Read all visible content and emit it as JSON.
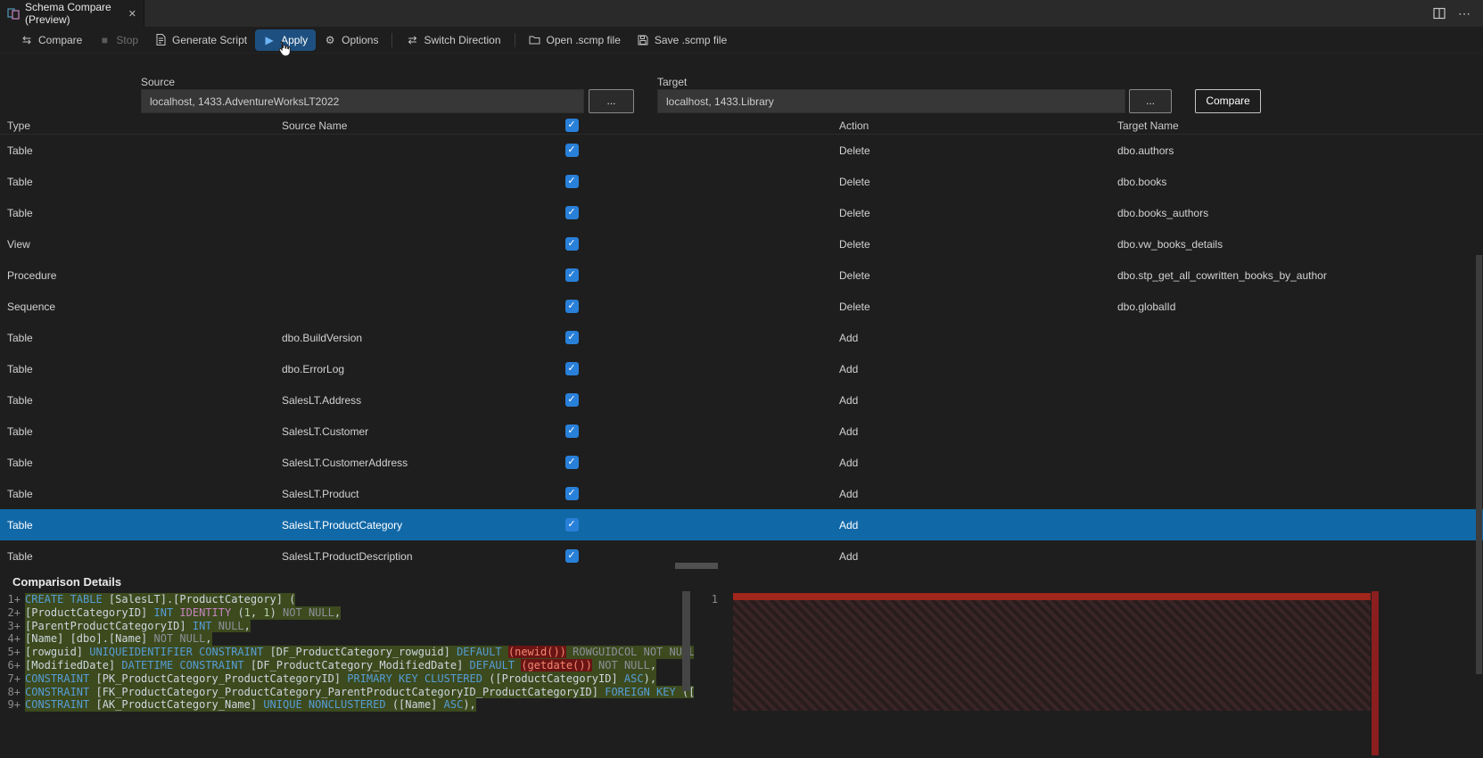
{
  "tab": {
    "title": "Schema Compare (Preview)",
    "close_glyph": "✕"
  },
  "window_controls": {
    "split_editor_icon": "split-editor",
    "more_actions_icon": "⋯"
  },
  "toolbar": {
    "items": [
      {
        "id": "compare",
        "label": "Compare",
        "enabled": true,
        "active": false
      },
      {
        "id": "stop",
        "label": "Stop",
        "enabled": false,
        "active": false
      },
      {
        "id": "generate-script",
        "label": "Generate Script",
        "enabled": true,
        "active": false
      },
      {
        "id": "apply",
        "label": "Apply",
        "enabled": true,
        "active": true
      },
      {
        "id": "options",
        "label": "Options",
        "enabled": true,
        "active": false
      },
      {
        "id": "switch-direction",
        "label": "Switch Direction",
        "enabled": true,
        "active": false
      },
      {
        "id": "open-scmp",
        "label": "Open .scmp file",
        "enabled": true,
        "active": false
      },
      {
        "id": "save-scmp",
        "label": "Save .scmp file",
        "enabled": true,
        "active": false
      }
    ]
  },
  "connections": {
    "source": {
      "label": "Source",
      "value": "localhost, 1433.AdventureWorksLT2022",
      "browse": "..."
    },
    "target": {
      "label": "Target",
      "value": "localhost, 1433.Library",
      "browse": "..."
    },
    "compare_button": "Compare"
  },
  "grid": {
    "headers": {
      "type": "Type",
      "source_name": "Source Name",
      "action": "Action",
      "target_name": "Target Name"
    },
    "header_checkbox_checked": true,
    "rows": [
      {
        "type": "Table",
        "source": "",
        "checked": true,
        "action": "Delete",
        "target": "dbo.authors",
        "selected": false
      },
      {
        "type": "Table",
        "source": "",
        "checked": true,
        "action": "Delete",
        "target": "dbo.books",
        "selected": false
      },
      {
        "type": "Table",
        "source": "",
        "checked": true,
        "action": "Delete",
        "target": "dbo.books_authors",
        "selected": false
      },
      {
        "type": "View",
        "source": "",
        "checked": true,
        "action": "Delete",
        "target": "dbo.vw_books_details",
        "selected": false
      },
      {
        "type": "Procedure",
        "source": "",
        "checked": true,
        "action": "Delete",
        "target": "dbo.stp_get_all_cowritten_books_by_author",
        "selected": false
      },
      {
        "type": "Sequence",
        "source": "",
        "checked": true,
        "action": "Delete",
        "target": "dbo.globalId",
        "selected": false
      },
      {
        "type": "Table",
        "source": "dbo.BuildVersion",
        "checked": true,
        "action": "Add",
        "target": "",
        "selected": false
      },
      {
        "type": "Table",
        "source": "dbo.ErrorLog",
        "checked": true,
        "action": "Add",
        "target": "",
        "selected": false
      },
      {
        "type": "Table",
        "source": "SalesLT.Address",
        "checked": true,
        "action": "Add",
        "target": "",
        "selected": false
      },
      {
        "type": "Table",
        "source": "SalesLT.Customer",
        "checked": true,
        "action": "Add",
        "target": "",
        "selected": false
      },
      {
        "type": "Table",
        "source": "SalesLT.CustomerAddress",
        "checked": true,
        "action": "Add",
        "target": "",
        "selected": false
      },
      {
        "type": "Table",
        "source": "SalesLT.Product",
        "checked": true,
        "action": "Add",
        "target": "",
        "selected": false
      },
      {
        "type": "Table",
        "source": "SalesLT.ProductCategory",
        "checked": true,
        "action": "Add",
        "target": "",
        "selected": true
      },
      {
        "type": "Table",
        "source": "SalesLT.ProductDescription",
        "checked": true,
        "action": "Add",
        "target": "",
        "selected": false
      }
    ]
  },
  "comparison": {
    "title": "Comparison Details",
    "left": {
      "lines": [
        {
          "num": "1",
          "marker": "+",
          "segments": [
            [
              "kw",
              "CREATE TABLE "
            ],
            [
              "id",
              "[SalesLT].[ProductCategory] ("
            ]
          ]
        },
        {
          "num": "2",
          "marker": "+",
          "segments": [
            [
              "id",
              "[ProductCategoryID] "
            ],
            [
              "kw",
              "INT "
            ],
            [
              "pink",
              "IDENTITY "
            ],
            [
              "id",
              "("
            ],
            [
              "num",
              "1"
            ],
            [
              "id",
              ", "
            ],
            [
              "num",
              "1"
            ],
            [
              "id",
              ") "
            ],
            [
              "mut",
              "NOT NULL"
            ],
            [
              "id",
              ","
            ]
          ]
        },
        {
          "num": "3",
          "marker": "+",
          "segments": [
            [
              "id",
              "[ParentProductCategoryID] "
            ],
            [
              "kw",
              "INT "
            ],
            [
              "mut",
              "NULL"
            ],
            [
              "id",
              ","
            ]
          ]
        },
        {
          "num": "4",
          "marker": "+",
          "segments": [
            [
              "id",
              "[Name] [dbo].[Name] "
            ],
            [
              "mut",
              "NOT NULL"
            ],
            [
              "id",
              ","
            ]
          ]
        },
        {
          "num": "5",
          "marker": "+",
          "segments": [
            [
              "id",
              "[rowguid] "
            ],
            [
              "kw",
              "UNIQUEIDENTIFIER "
            ],
            [
              "kw",
              "CONSTRAINT "
            ],
            [
              "id",
              "[DF_ProductCategory_rowguid] "
            ],
            [
              "kw",
              "DEFAULT "
            ],
            [
              "red",
              "(newid())"
            ],
            [
              "id",
              " "
            ],
            [
              "mut",
              "ROWGUIDCOL NOT NULL"
            ],
            [
              "id",
              ","
            ]
          ]
        },
        {
          "num": "6",
          "marker": "+",
          "segments": [
            [
              "id",
              "[ModifiedDate] "
            ],
            [
              "kw",
              "DATETIME "
            ],
            [
              "kw",
              "CONSTRAINT "
            ],
            [
              "id",
              "[DF_ProductCategory_ModifiedDate] "
            ],
            [
              "kw",
              "DEFAULT "
            ],
            [
              "red",
              "(getdate())"
            ],
            [
              "id",
              " "
            ],
            [
              "mut",
              "NOT NULL"
            ],
            [
              "id",
              ","
            ]
          ]
        },
        {
          "num": "7",
          "marker": "+",
          "segments": [
            [
              "kw",
              "CONSTRAINT "
            ],
            [
              "id",
              "[PK_ProductCategory_ProductCategoryID] "
            ],
            [
              "kw",
              "PRIMARY KEY CLUSTERED "
            ],
            [
              "id",
              "([ProductCategoryID] "
            ],
            [
              "kw",
              "ASC"
            ],
            [
              "id",
              "),"
            ]
          ]
        },
        {
          "num": "8",
          "marker": "+",
          "segments": [
            [
              "kw",
              "CONSTRAINT "
            ],
            [
              "id",
              "[FK_ProductCategory_ProductCategory_ParentProductCategoryID_ProductCategoryID] "
            ],
            [
              "kw",
              "FOREIGN KEY "
            ],
            [
              "id",
              "([ParentProductCatego"
            ]
          ]
        },
        {
          "num": "9",
          "marker": "+",
          "segments": [
            [
              "kw",
              "CONSTRAINT "
            ],
            [
              "id",
              "[AK_ProductCategory_Name] "
            ],
            [
              "kw",
              "UNIQUE NONCLUSTERED "
            ],
            [
              "id",
              "([Name] "
            ],
            [
              "kw",
              "ASC"
            ],
            [
              "id",
              "),"
            ]
          ]
        }
      ]
    },
    "right": {
      "lines": [
        {
          "num": "1"
        }
      ]
    }
  },
  "colors": {
    "accent_checkbox": "#2980d9",
    "selected_row": "#1168a7",
    "apply_highlight": "#1d5080",
    "added_line_bg": "#3c4a1e",
    "removed_fill": "#8b1e1e",
    "keyword": "#569cd6"
  }
}
